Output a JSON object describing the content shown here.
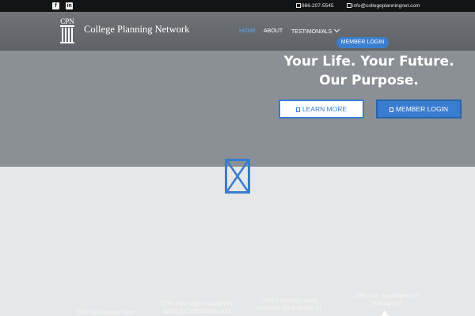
{
  "topbar": {
    "facebook_icon": "facebook-icon",
    "linkedin_icon": "linkedin-icon",
    "facebook_glyph": "f",
    "linkedin_glyph": "in",
    "phone": "866-207-5545",
    "email": "info@collegeplanningnet.com"
  },
  "header": {
    "logo_mark": "CPN",
    "brand": "College Planning Network",
    "nav": {
      "home": "HOME",
      "about": "ABOUT",
      "testimonials": "TESTIMONIALS",
      "member_login": "MEMBER LOGIN"
    }
  },
  "hero": {
    "headline_line1": "Your Life. Your Future.",
    "headline_line2": "Our Purpose.",
    "learn_more": "LEARN MORE",
    "member_login": "MEMBER LOGIN"
  },
  "stats": [
    {
      "line1": "CPN has helped over"
    },
    {
      "line1": "CPN has helped students",
      "line2": "apply for admission and"
    },
    {
      "line1": "CPN's families have",
      "line2": "received an average of"
    },
    {
      "line1": "CPN has negotiated an",
      "line2": "average of"
    }
  ],
  "colors": {
    "accent": "#3a7ccf",
    "nav_active": "#5aa6ec",
    "hero_bg": "#8b9096",
    "topbar_bg": "#121416"
  }
}
